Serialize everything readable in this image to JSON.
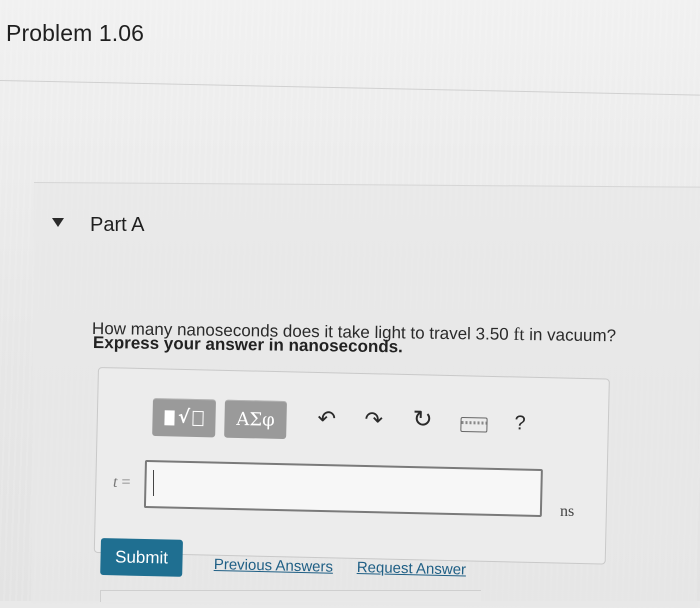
{
  "problem": {
    "title": "Problem 1.06"
  },
  "part": {
    "label": "Part A",
    "question_prefix": "How many nanoseconds does it take light to travel 3.50 ",
    "question_unit": "ft",
    "question_suffix": " in vacuum?",
    "instruction": "Express your answer in nanoseconds."
  },
  "toolbar": {
    "templates_icon": "templates-radical-icon",
    "symbols_label": "ΑΣφ",
    "undo_icon": "undo-icon",
    "redo_icon": "redo-icon",
    "reset_icon": "reset-icon",
    "keyboard_icon": "keyboard-icon",
    "help_label": "?"
  },
  "answer": {
    "variable": "t",
    "equals": "=",
    "value": "",
    "unit": "ns"
  },
  "actions": {
    "submit_label": "Submit",
    "previous_answers_label": "Previous Answers",
    "request_answer_label": "Request Answer"
  },
  "colors": {
    "submit_bg": "#1f6f91",
    "link": "#1f5f85",
    "toolbar_button": "#9a9a9a"
  }
}
